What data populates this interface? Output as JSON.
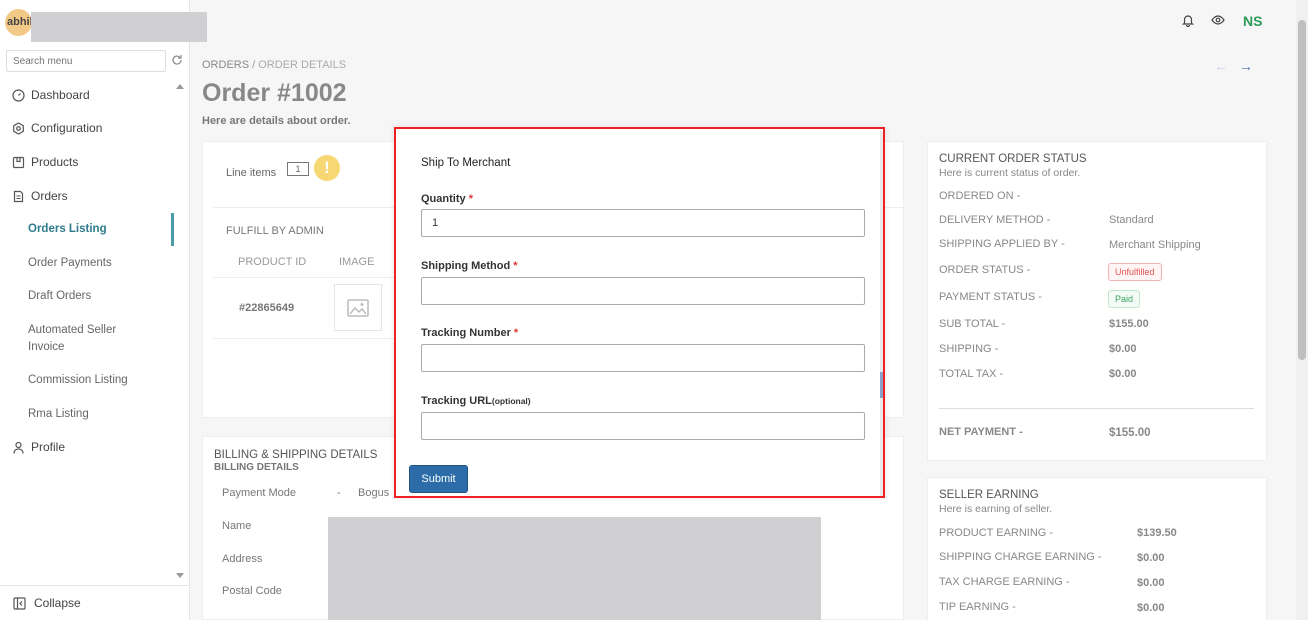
{
  "user": {
    "avatar_text": "abhil"
  },
  "sidebar": {
    "search_placeholder": "Search menu",
    "items": [
      {
        "label": "Dashboard"
      },
      {
        "label": "Configuration"
      },
      {
        "label": "Products"
      },
      {
        "label": "Orders"
      },
      {
        "label": "Profile"
      }
    ],
    "order_subitems": [
      {
        "label": "Orders Listing"
      },
      {
        "label": "Order Payments"
      },
      {
        "label": "Draft Orders"
      },
      {
        "label": "Automated Seller"
      },
      {
        "label": "Invoice"
      },
      {
        "label": "Commission Listing"
      },
      {
        "label": "Rma Listing"
      }
    ],
    "collapse_label": "Collapse"
  },
  "topbar": {
    "initials": "NS"
  },
  "header": {
    "breadcrumb_orders": "ORDERS",
    "breadcrumb_sep": " / ",
    "breadcrumb_details": "ORDER DETAILS",
    "title": "Order #1002",
    "subtitle": "Here are details about order."
  },
  "line_items": {
    "label": "Line items",
    "count": "1",
    "fulfill_title": "FULFILL BY ADMIN",
    "col_product_id": "PRODUCT ID",
    "col_image": "IMAGE",
    "product_id": "#22865649"
  },
  "billing": {
    "title": "BILLING & SHIPPING DETAILS",
    "subtitle": "BILLING DETAILS",
    "payment_mode_label": "Payment Mode",
    "payment_mode_sep": "-",
    "payment_mode_value": "Bogus",
    "name_label": "Name",
    "address_label": "Address",
    "postal_label": "Postal Code"
  },
  "order_status": {
    "title": "CURRENT ORDER STATUS",
    "subtitle": "Here is current status of order.",
    "ordered_on_label": "ORDERED ON -",
    "delivery_label": "DELIVERY METHOD -",
    "delivery_value": "Standard",
    "shipping_applied_label": "SHIPPING APPLIED BY -",
    "shipping_applied_value": "Merchant Shipping",
    "order_status_label": "ORDER STATUS -",
    "order_status_value": "Unfulfilled",
    "payment_status_label": "PAYMENT STATUS -",
    "payment_status_value": "Paid",
    "subtotal_label": "SUB TOTAL -",
    "subtotal_value": "$155.00",
    "shipping_label": "SHIPPING -",
    "shipping_value": "$0.00",
    "tax_label": "TOTAL TAX -",
    "tax_value": "$0.00",
    "net_label": "NET PAYMENT -",
    "net_value": "$155.00"
  },
  "seller_earning": {
    "title": "SELLER EARNING",
    "subtitle": "Here is earning of seller.",
    "product_label": "PRODUCT EARNING -",
    "product_value": "$139.50",
    "shipping_label": "SHIPPING CHARGE EARNING -",
    "shipping_value": "$0.00",
    "tax_label": "TAX CHARGE EARNING -",
    "tax_value": "$0.00",
    "tip_label": "TIP EARNING -",
    "tip_value": "$0.00"
  },
  "modal": {
    "title": "Ship To Merchant",
    "quantity_label": "Quantity",
    "quantity_value": "1",
    "shipping_method_label": "Shipping Method",
    "tracking_number_label": "Tracking Number",
    "tracking_url_label": "Tracking URL",
    "optional_text": "(optional)",
    "required_mark": "*",
    "submit_label": "Submit"
  },
  "colors": {
    "accent": "#2c6da9",
    "active_nav": "#2e7b8c",
    "unfulfilled": "#e05555",
    "paid": "#3aa55d",
    "modal_border": "#e22222"
  }
}
